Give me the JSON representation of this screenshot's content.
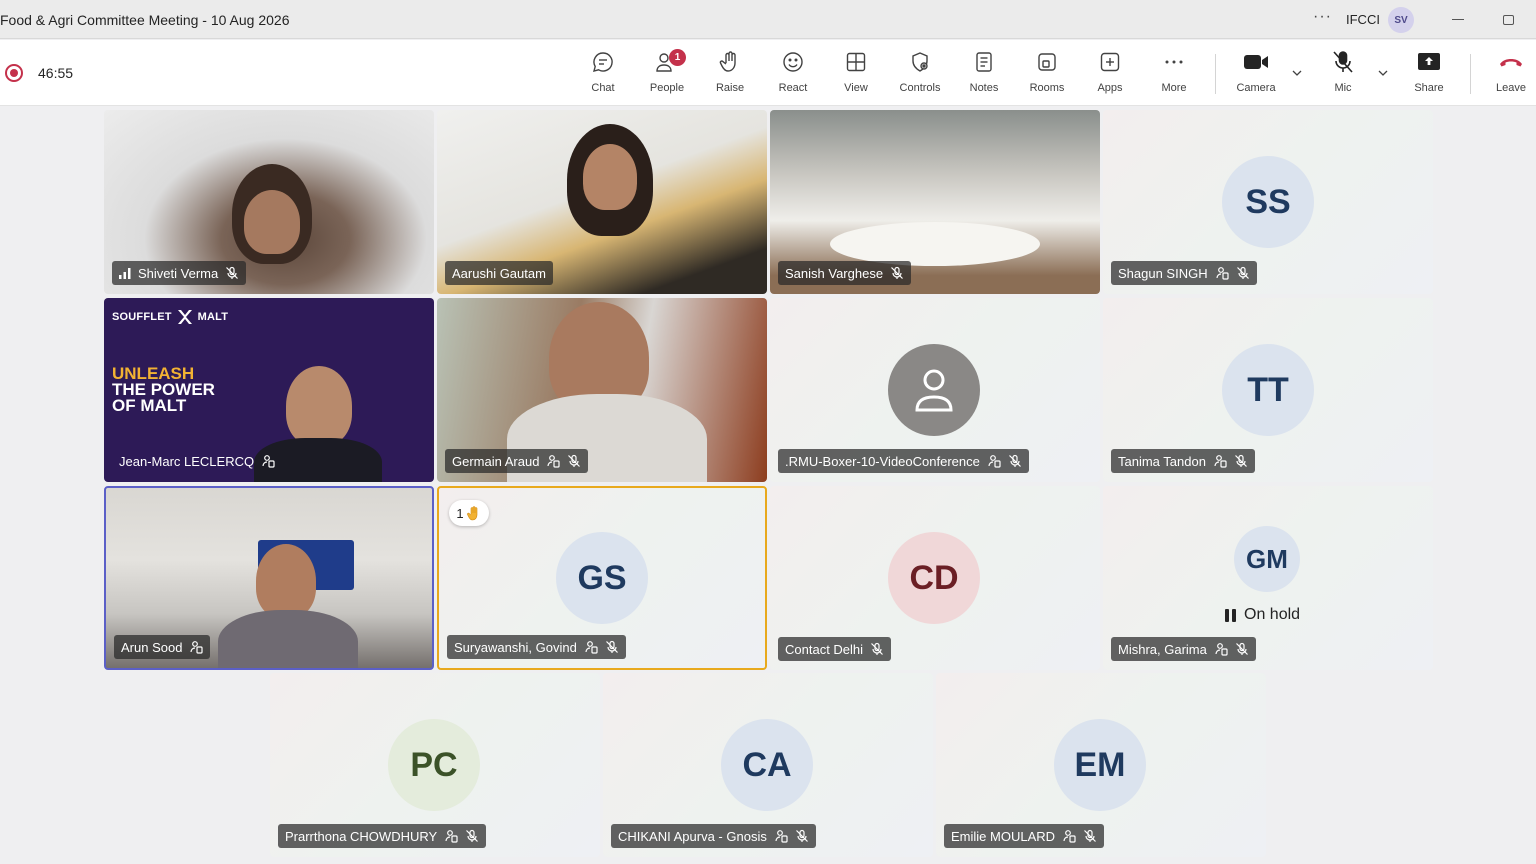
{
  "window": {
    "title": "Food & Agri Committee Meeting - 10 Aug 2026",
    "org": "IFCCI",
    "user_initials": "SV"
  },
  "toolbar": {
    "timer": "46:55",
    "chat": "Chat",
    "people": "People",
    "people_badge": "1",
    "raise": "Raise",
    "react": "React",
    "view": "View",
    "controls": "Controls",
    "notes": "Notes",
    "rooms": "Rooms",
    "apps": "Apps",
    "more": "More",
    "camera": "Camera",
    "mic": "Mic",
    "share": "Share",
    "leave": "Leave"
  },
  "colors": {
    "accent": "#5b5fc7",
    "record_red": "#c4314b",
    "hand_highlight": "#e8a91d",
    "leave_red": "#c4314b"
  },
  "participants": [
    {
      "name": "Shiveti Verma",
      "type": "video"
    },
    {
      "name": "Aarushi Gautam",
      "type": "video"
    },
    {
      "name": "Sanish Varghese",
      "type": "video"
    },
    {
      "name": "Shagun SINGH",
      "initials": "SS",
      "type": "avatar"
    },
    {
      "name": "Jean-Marc LECLERCQ",
      "type": "video"
    },
    {
      "name": "Germain Araud",
      "type": "video"
    },
    {
      "name": ".RMU-Boxer-10-VideoConference",
      "type": "avatar-icon"
    },
    {
      "name": "Tanima Tandon",
      "initials": "TT",
      "type": "avatar"
    },
    {
      "name": "Arun Sood",
      "type": "video"
    },
    {
      "name": "Suryawanshi, Govind",
      "initials": "GS",
      "type": "avatar",
      "raised_hand_count": "1"
    },
    {
      "name": "Contact Delhi",
      "initials": "CD",
      "type": "avatar"
    },
    {
      "name": "Mishra, Garima",
      "initials": "GM",
      "type": "avatar",
      "status": "On hold"
    },
    {
      "name": "Prarrthona CHOWDHURY",
      "initials": "PC",
      "type": "avatar"
    },
    {
      "name": "CHIKANI Apurva - Gnosis",
      "initials": "CA",
      "type": "avatar"
    },
    {
      "name": "Emilie MOULARD",
      "initials": "EM",
      "type": "avatar"
    }
  ],
  "brand_panel": {
    "logo_left": "SOUFFLET",
    "logo_right": "MALT",
    "headline_1": "UNLEASH",
    "headline_2": "THE POWER OF MALT"
  }
}
